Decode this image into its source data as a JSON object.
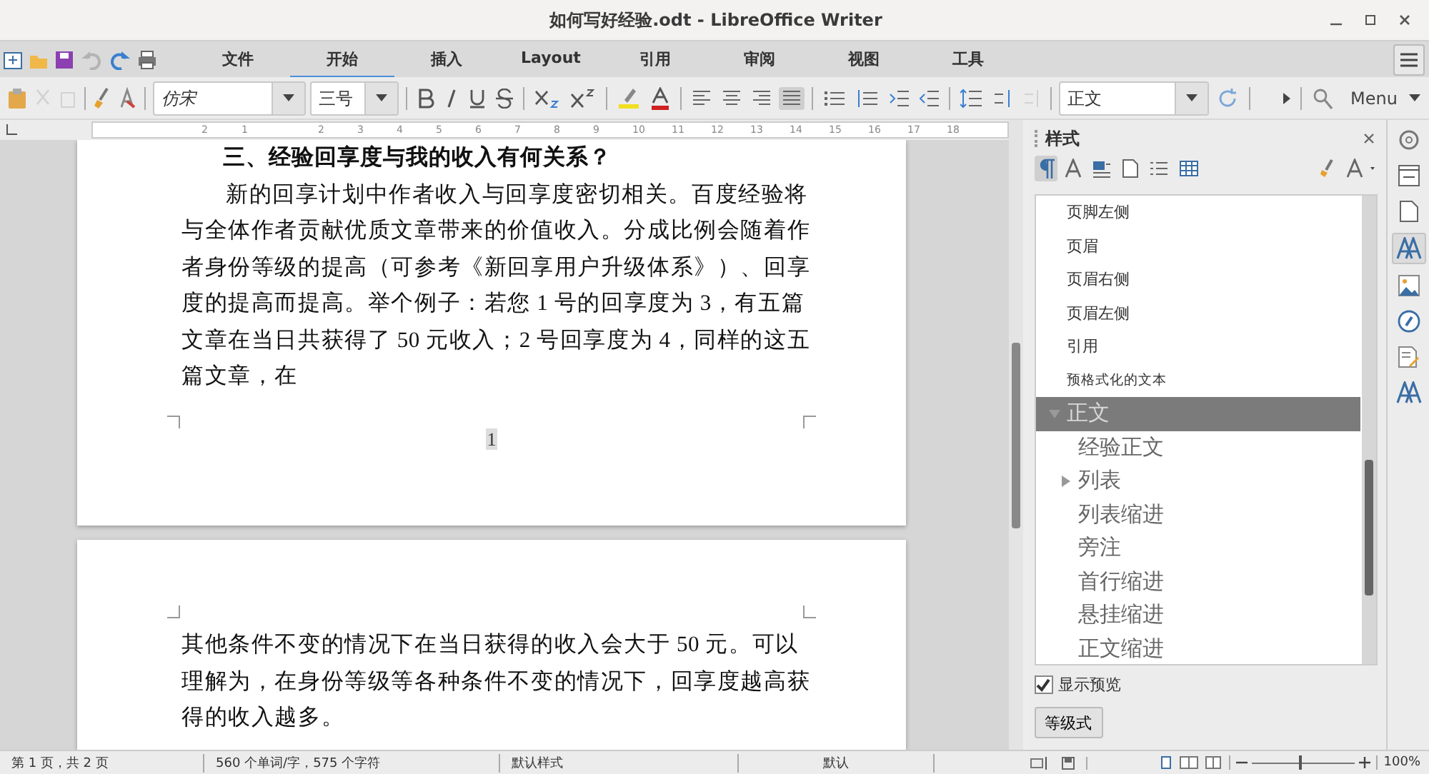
{
  "window": {
    "title": "如何写好经验.odt - LibreOffice Writer"
  },
  "tabs": [
    {
      "label": "文件",
      "selected": false
    },
    {
      "label": "开始",
      "selected": true
    },
    {
      "label": "插入",
      "selected": false
    },
    {
      "label": "Layout",
      "selected": false
    },
    {
      "label": "引用",
      "selected": false
    },
    {
      "label": "审阅",
      "selected": false
    },
    {
      "label": "视图",
      "selected": false
    },
    {
      "label": "工具",
      "selected": false
    }
  ],
  "toolbar": {
    "font_name": "仿宋",
    "font_size": "三号",
    "paragraph_style": "正文",
    "menu": "Menu"
  },
  "ruler": [
    "2",
    "1",
    "2",
    "3",
    "4",
    "5",
    "6",
    "7",
    "8",
    "9",
    "10",
    "11",
    "12",
    "13",
    "14",
    "15",
    "16",
    "17",
    "18"
  ],
  "document": {
    "pages": [
      {
        "blocks": [
          {
            "kind": "heading",
            "text": "三、经验回享度与我的收入有何关系？"
          },
          {
            "kind": "paragraph",
            "text": "新的回享计划中作者收入与回享度密切相关。百度经验将与全体作者贡献优质文章带来的价值收入。分成比例会随着作者身份等级的提高（可参考《新回享用户升级体系》）、回享度的提高而提高。举个例子：若您 1 号的回享度为 3，有五篇文章在当日共获得了 50 元收入；2 号回享度为 4，同样的这五篇文章，在"
          }
        ],
        "page_number": "1"
      },
      {
        "blocks": [
          {
            "kind": "body",
            "text": "其他条件不变的情况下在当日获得的收入会大于 50 元。可以理解为，在身份等级等各种条件不变的情况下，回享度越高获得的收入越多。"
          }
        ]
      }
    ]
  },
  "sidebar": {
    "title": "样式",
    "styles": [
      {
        "label": "页脚左侧",
        "kind": "small",
        "selected": false
      },
      {
        "label": "页眉",
        "kind": "small",
        "selected": false
      },
      {
        "label": "页眉右侧",
        "kind": "small",
        "selected": false
      },
      {
        "label": "页眉左侧",
        "kind": "small",
        "selected": false
      },
      {
        "label": "引用",
        "kind": "small",
        "selected": false
      },
      {
        "label": "预格式化的文本",
        "kind": "tiny",
        "selected": false
      },
      {
        "label": "正文",
        "kind": "large",
        "selected": true,
        "expanded": true,
        "children": [
          {
            "label": "经验正文",
            "kind": "large",
            "selected": false
          },
          {
            "label": "列表",
            "kind": "large",
            "selected": false,
            "expanded": false
          },
          {
            "label": "列表缩进",
            "kind": "large",
            "selected": false
          },
          {
            "label": "旁注",
            "kind": "large",
            "selected": false
          },
          {
            "label": "首行缩进",
            "kind": "large",
            "selected": false
          },
          {
            "label": "悬挂缩进",
            "kind": "large",
            "selected": false
          },
          {
            "label": "正文缩进",
            "kind": "large",
            "selected": false
          }
        ]
      }
    ],
    "show_preview": {
      "label": "显示预览",
      "checked": true
    },
    "filter": "等级式"
  },
  "status_bar": {
    "page": "第 1 页，共 2 页",
    "words": "560 个单词/字，575 个字符",
    "page_style": "默认样式",
    "language": "默认",
    "zoom": {
      "level": 0.45,
      "reading": "100%"
    }
  }
}
